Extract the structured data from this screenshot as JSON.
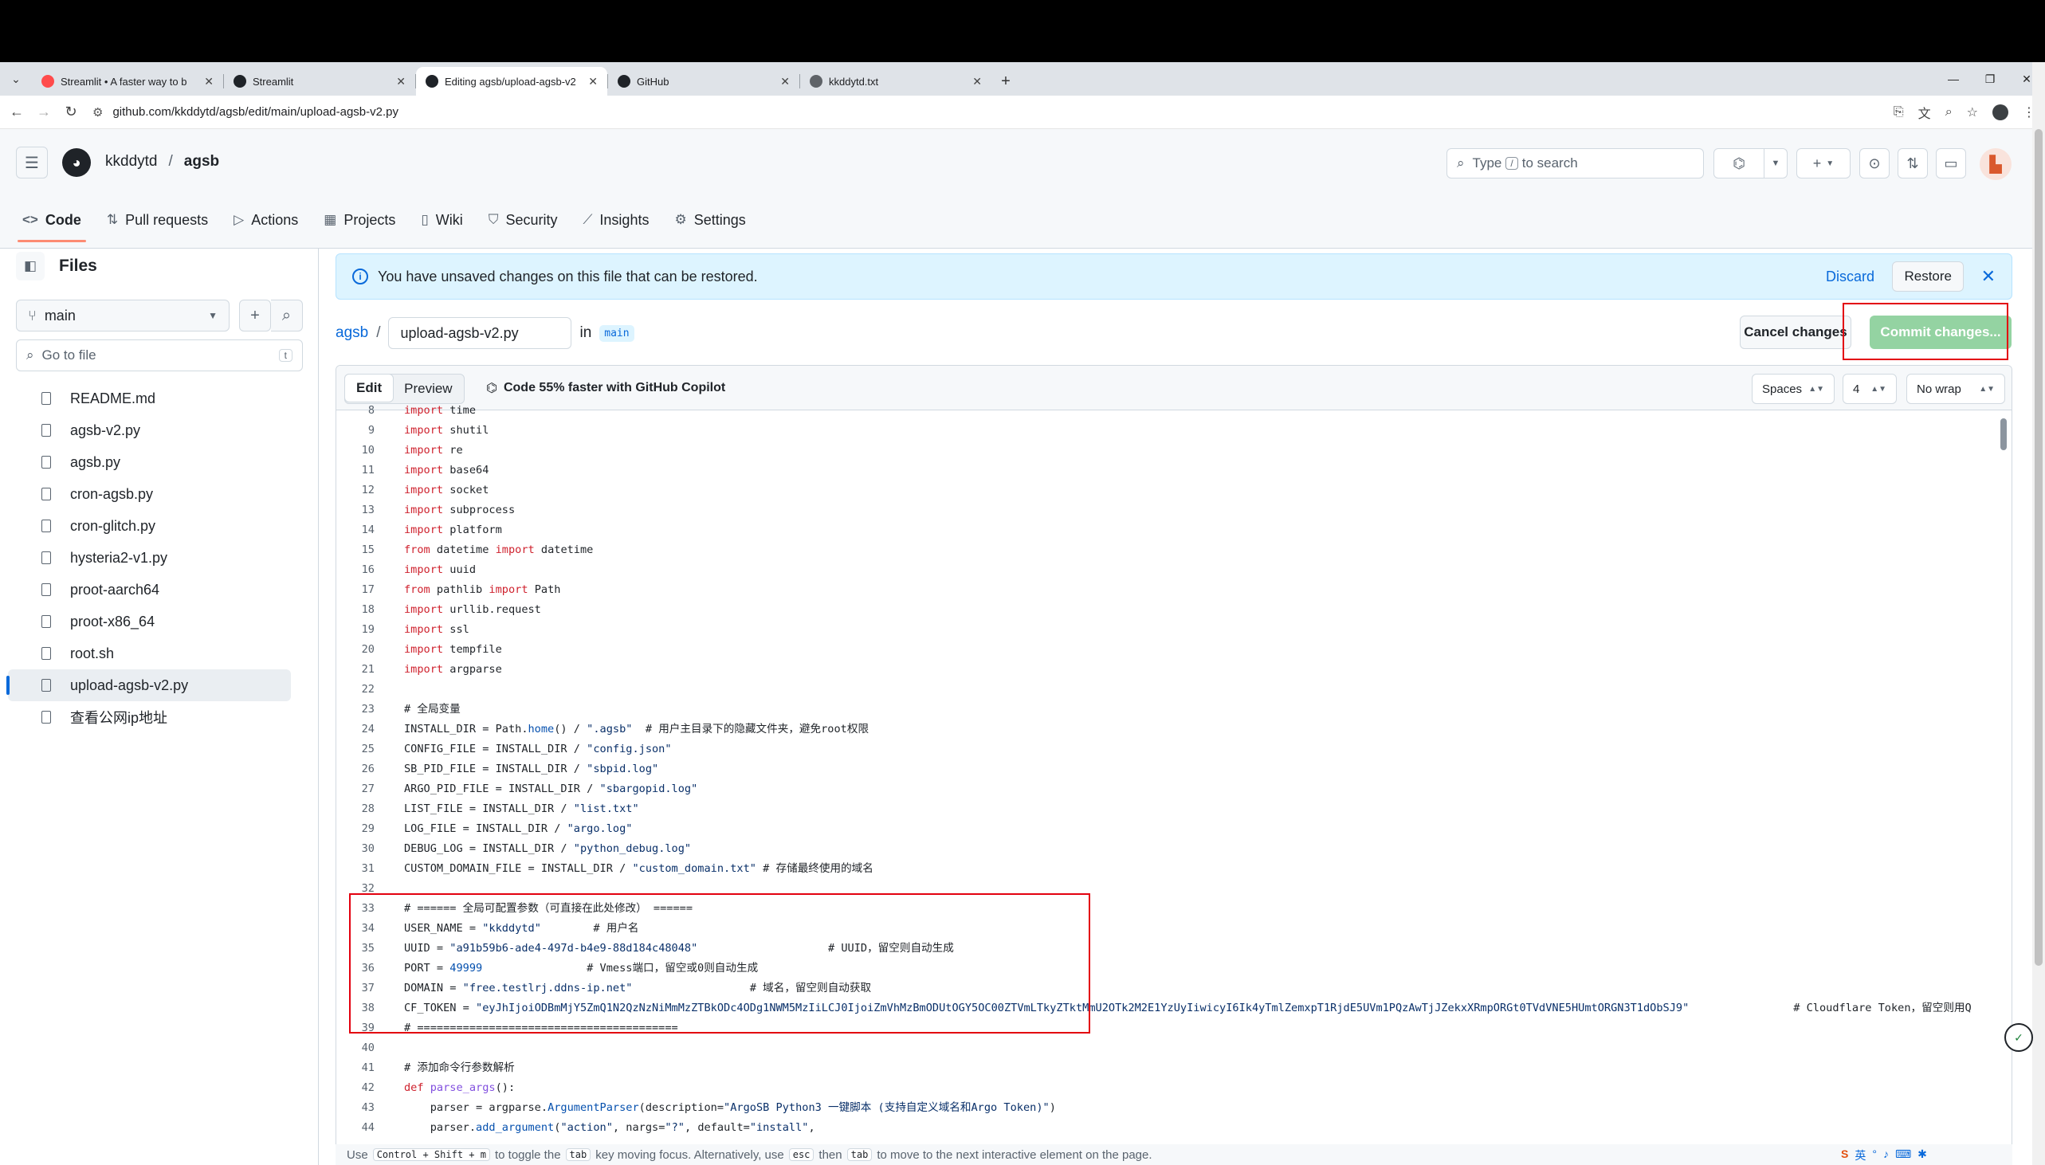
{
  "browser": {
    "tabs": [
      {
        "title": "Streamlit • A faster way to b",
        "icon": "streamlit-crown-icon",
        "color": "#ff4b4b"
      },
      {
        "title": "Streamlit",
        "icon": "github-icon",
        "color": "#1f2328"
      },
      {
        "title": "Editing agsb/upload-agsb-v2",
        "icon": "github-icon",
        "color": "#1f2328",
        "active": true
      },
      {
        "title": "GitHub",
        "icon": "github-icon",
        "color": "#1f2328"
      },
      {
        "title": "kkddytd.txt",
        "icon": "globe-icon",
        "color": "#5f6368"
      }
    ],
    "url": "github.com/kkddytd/agsb/edit/main/upload-agsb-v2.py"
  },
  "header": {
    "owner": "kkddytd",
    "separator": "/",
    "repo": "agsb",
    "search_prefix": "Type",
    "search_key": "/",
    "search_suffix": "to search"
  },
  "repo_tabs": [
    {
      "label": "Code",
      "icon": "code-icon",
      "selected": true
    },
    {
      "label": "Pull requests",
      "icon": "pull-request-icon"
    },
    {
      "label": "Actions",
      "icon": "play-icon"
    },
    {
      "label": "Projects",
      "icon": "table-icon"
    },
    {
      "label": "Wiki",
      "icon": "book-icon"
    },
    {
      "label": "Security",
      "icon": "shield-icon"
    },
    {
      "label": "Insights",
      "icon": "graph-icon"
    },
    {
      "label": "Settings",
      "icon": "gear-icon"
    }
  ],
  "sidebar": {
    "title": "Files",
    "branch": "main",
    "goto_placeholder": "Go to file",
    "goto_key": "t",
    "files": [
      "README.md",
      "agsb-v2.py",
      "agsb.py",
      "cron-agsb.py",
      "cron-glitch.py",
      "hysteria2-v1.py",
      "proot-aarch64",
      "proot-x86_64",
      "root.sh",
      "upload-agsb-v2.py",
      "查看公网ip地址"
    ],
    "selected_file": "upload-agsb-v2.py"
  },
  "banner": {
    "message": "You have unsaved changes on this file that can be restored.",
    "discard": "Discard",
    "restore": "Restore"
  },
  "editor": {
    "repo_link": "agsb",
    "slash": "/",
    "filename": "upload-agsb-v2.py",
    "in": "in",
    "branch": "main",
    "cancel_label": "Cancel changes",
    "commit_label": "Commit changes...",
    "edit_tab": "Edit",
    "preview_tab": "Preview",
    "copilot_text": "Code 55% faster with GitHub Copilot",
    "indent_mode": "Spaces",
    "indent_size": "4",
    "wrap_mode": "No wrap"
  },
  "code_lines": [
    {
      "n": "8",
      "t": "import time"
    },
    {
      "n": "9",
      "t": "import shutil"
    },
    {
      "n": "10",
      "t": "import re"
    },
    {
      "n": "11",
      "t": "import base64"
    },
    {
      "n": "12",
      "t": "import socket"
    },
    {
      "n": "13",
      "t": "import subprocess"
    },
    {
      "n": "14",
      "t": "import platform"
    },
    {
      "n": "15",
      "t": "from datetime import datetime"
    },
    {
      "n": "16",
      "t": "import uuid"
    },
    {
      "n": "17",
      "t": "from pathlib import Path"
    },
    {
      "n": "18",
      "t": "import urllib.request"
    },
    {
      "n": "19",
      "t": "import ssl"
    },
    {
      "n": "20",
      "t": "import tempfile"
    },
    {
      "n": "21",
      "t": "import argparse"
    },
    {
      "n": "22",
      "t": ""
    },
    {
      "n": "23",
      "t": "# 全局变量"
    },
    {
      "n": "24",
      "t": "INSTALL_DIR = Path.home() / \".agsb\"  # 用户主目录下的隐藏文件夹，避免root权限"
    },
    {
      "n": "25",
      "t": "CONFIG_FILE = INSTALL_DIR / \"config.json\""
    },
    {
      "n": "26",
      "t": "SB_PID_FILE = INSTALL_DIR / \"sbpid.log\""
    },
    {
      "n": "27",
      "t": "ARGO_PID_FILE = INSTALL_DIR / \"sbargopid.log\""
    },
    {
      "n": "28",
      "t": "LIST_FILE = INSTALL_DIR / \"list.txt\""
    },
    {
      "n": "29",
      "t": "LOG_FILE = INSTALL_DIR / \"argo.log\""
    },
    {
      "n": "30",
      "t": "DEBUG_LOG = INSTALL_DIR / \"python_debug.log\""
    },
    {
      "n": "31",
      "t": "CUSTOM_DOMAIN_FILE = INSTALL_DIR / \"custom_domain.txt\" # 存储最终使用的域名"
    },
    {
      "n": "32",
      "t": ""
    },
    {
      "n": "33",
      "t": "# ====== 全局可配置参数（可直接在此处修改） ======"
    },
    {
      "n": "34",
      "t": "USER_NAME = \"kkddytd\"        # 用户名"
    },
    {
      "n": "35",
      "t": "UUID = \"a91b59b6-ade4-497d-b4e9-88d184c48048\"                    # UUID，留空则自动生成"
    },
    {
      "n": "36",
      "t": "PORT = 49999                # Vmess端口，留空或0则自动生成"
    },
    {
      "n": "37",
      "t": "DOMAIN = \"free.testlrj.ddns-ip.net\"                  # 域名，留空则自动获取"
    },
    {
      "n": "38",
      "t": "CF_TOKEN = \"eyJhIjoiODBmMjY5ZmQ1N2QzNzNiMmMzZTBkODc4ODg1NWM5MzIiLCJ0IjoiZmVhMzBmODUtOGY5OC00ZTVmLTkyZTktMmU2OTk2M2E1YzUyIiwicyI6Ik4yTmlZemxpT1RjdE5UVm1PQzAwTjJZekxXRmpORGt0TVdVNE5HUmtORGN3T1dObSJ9\"                # Cloudflare Token，留空则用Q"
    },
    {
      "n": "39",
      "t": "# ========================================"
    },
    {
      "n": "40",
      "t": ""
    },
    {
      "n": "41",
      "t": "# 添加命令行参数解析"
    },
    {
      "n": "42",
      "t": "def parse_args():"
    },
    {
      "n": "43",
      "t": "    parser = argparse.ArgumentParser(description=\"ArgoSB Python3 一键脚本 (支持自定义域名和Argo Token)\")"
    },
    {
      "n": "44",
      "t": "    parser.add_argument(\"action\", nargs=\"?\", default=\"install\","
    }
  ],
  "statusbar": {
    "p1": "Use",
    "k1": "Control + Shift + m",
    "p2": "to toggle the",
    "k2": "tab",
    "p3": "key moving focus. Alternatively, use",
    "k3": "esc",
    "p4": "then",
    "k4": "tab",
    "p5": "to move to the next interactive element on the page."
  },
  "ime": {
    "label": "英"
  }
}
